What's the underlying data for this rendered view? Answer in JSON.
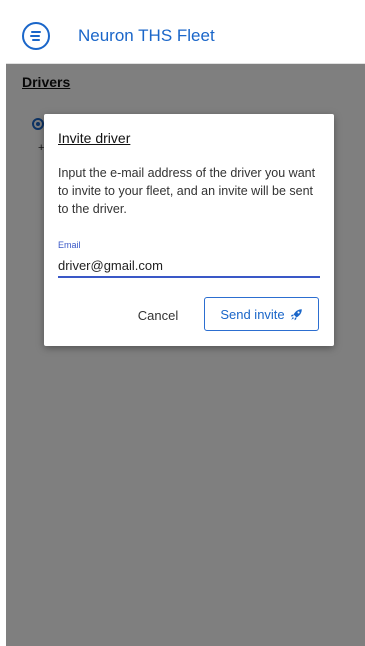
{
  "header": {
    "title": "Neuron THS Fleet",
    "menu_icon": "menu-circle-icon"
  },
  "page": {
    "heading": "Drivers",
    "add_peek": "+"
  },
  "dialog": {
    "title": "Invite driver",
    "body": "Input the e-mail address of the driver you want to invite to your fleet, and an invite will be sent to the driver.",
    "email_label": "Email",
    "email_value": "driver@gmail.com",
    "cancel_label": "Cancel",
    "send_label": "Send invite",
    "send_icon": "rocket-icon"
  },
  "colors": {
    "accent": "#1a66c9",
    "input_underline": "#3a58c7",
    "overlay": "rgba(0,0,0,0.5)"
  }
}
